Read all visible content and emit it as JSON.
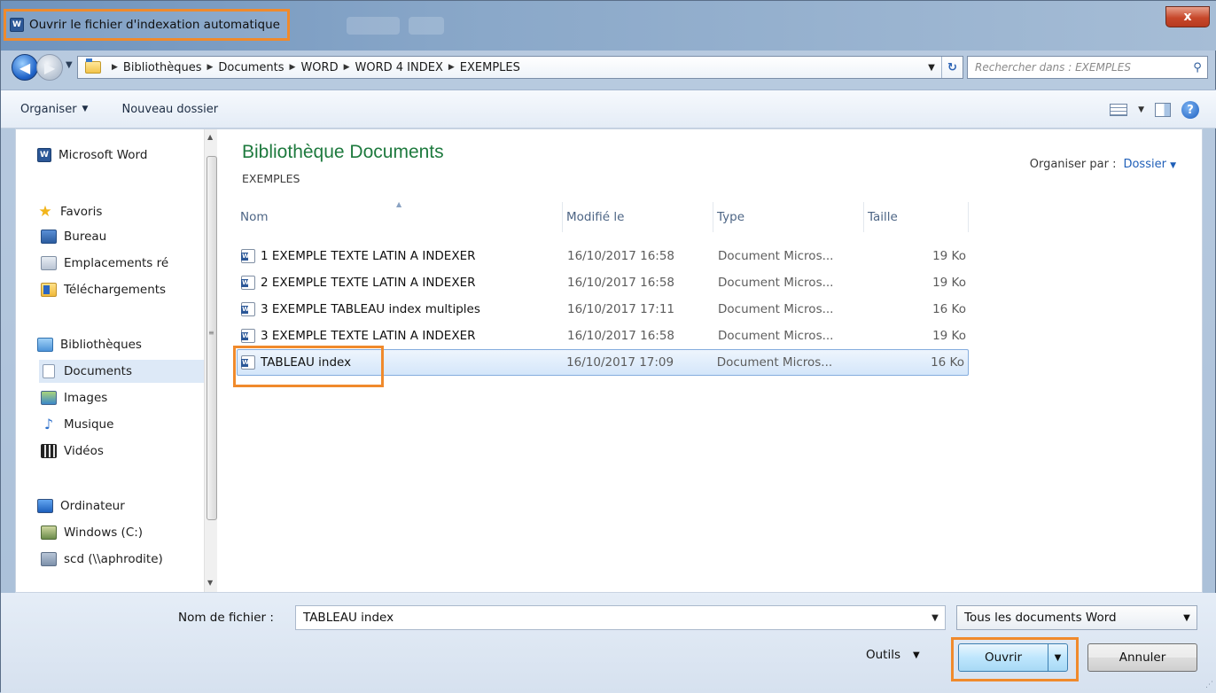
{
  "window": {
    "title": "Ouvrir le fichier d'indexation automatique",
    "close_label": "x"
  },
  "address": {
    "crumbs": [
      "Bibliothèques",
      "Documents",
      "WORD",
      "WORD 4 INDEX",
      "EXEMPLES"
    ],
    "refresh_glyph": "↻",
    "search_placeholder": "Rechercher dans : EXEMPLES"
  },
  "toolbar": {
    "organize_label": "Organiser",
    "new_folder_label": "Nouveau dossier"
  },
  "sidebar": {
    "items": [
      {
        "label": "Microsoft Word",
        "icon": "word-icon"
      },
      {
        "label": "Favoris",
        "icon": "star-icon"
      },
      {
        "label": "Bureau",
        "icon": "desktop-icon"
      },
      {
        "label": "Emplacements ré",
        "icon": "recent-places-icon"
      },
      {
        "label": "Téléchargements",
        "icon": "downloads-icon"
      },
      {
        "label": "Bibliothèques",
        "icon": "libraries-icon"
      },
      {
        "label": "Documents",
        "icon": "documents-icon"
      },
      {
        "label": "Images",
        "icon": "images-icon"
      },
      {
        "label": "Musique",
        "icon": "music-icon"
      },
      {
        "label": "Vidéos",
        "icon": "videos-icon"
      },
      {
        "label": "Ordinateur",
        "icon": "computer-icon"
      },
      {
        "label": "Windows (C:)",
        "icon": "drive-icon"
      },
      {
        "label": "scd (\\\\aphrodite)",
        "icon": "network-drive-icon"
      }
    ]
  },
  "library": {
    "title": "Bibliothèque Documents",
    "subtitle": "EXEMPLES",
    "arrange_label": "Organiser par :",
    "arrange_value": "Dossier"
  },
  "columns": {
    "name": "Nom",
    "modified": "Modifié le",
    "type": "Type",
    "size": "Taille"
  },
  "files": [
    {
      "name": "1 EXEMPLE TEXTE LATIN A INDEXER",
      "modified": "16/10/2017 16:58",
      "type": "Document Micros...",
      "size": "19 Ko"
    },
    {
      "name": "2 EXEMPLE TEXTE LATIN A INDEXER",
      "modified": "16/10/2017 16:58",
      "type": "Document Micros...",
      "size": "19 Ko"
    },
    {
      "name": "3 EXEMPLE TABLEAU index multiples",
      "modified": "16/10/2017 17:11",
      "type": "Document Micros...",
      "size": "16 Ko"
    },
    {
      "name": "3 EXEMPLE TEXTE LATIN A INDEXER",
      "modified": "16/10/2017 16:58",
      "type": "Document Micros...",
      "size": "19 Ko"
    },
    {
      "name": "TABLEAU index",
      "modified": "16/10/2017 17:09",
      "type": "Document Micros...",
      "size": "16 Ko"
    }
  ],
  "footer": {
    "filename_label": "Nom de fichier :",
    "filename_value": "TABLEAU index",
    "filetype_value": "Tous les documents Word",
    "tools_label": "Outils",
    "open_label": "Ouvrir",
    "cancel_label": "Annuler"
  },
  "colors": {
    "accent_highlight": "#f08a2c",
    "library_title": "#1e7a3e",
    "selection": "#d4e6fa"
  }
}
